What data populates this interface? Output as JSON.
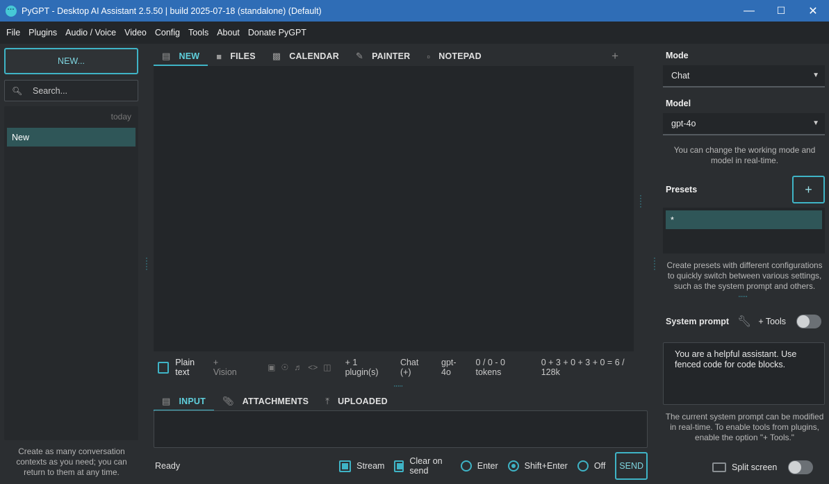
{
  "window": {
    "title": "PyGPT - Desktop AI Assistant 2.5.50 | build 2025-07-18 (standalone) (Default)",
    "minimize": "—",
    "maximize": "☐",
    "close": "✕"
  },
  "menu": [
    "File",
    "Plugins",
    "Audio / Voice",
    "Video",
    "Config",
    "Tools",
    "About",
    "Donate PyGPT"
  ],
  "left": {
    "new_button": "NEW...",
    "search_placeholder": "Search...",
    "group_label": "today",
    "contexts": [
      "New"
    ],
    "hint": "Create as many conversation contexts as you need; you can return to them at any time."
  },
  "tabs": [
    {
      "label": "NEW",
      "icon": "chat-icon",
      "active": true
    },
    {
      "label": "FILES",
      "icon": "folder-icon",
      "active": false
    },
    {
      "label": "CALENDAR",
      "icon": "calendar-icon",
      "active": false
    },
    {
      "label": "PAINTER",
      "icon": "brush-icon",
      "active": false
    },
    {
      "label": "NOTEPAD",
      "icon": "clipboard-icon",
      "active": false
    }
  ],
  "status": {
    "plain_text": "Plain text",
    "vision": "+ Vision",
    "plugins": "+ 1 plugin(s)",
    "mode": "Chat (+)",
    "model": "gpt-4o",
    "tokens": "0 / 0 - 0 tokens",
    "ctx": "0 + 3 + 0 + 3 + 0 = 6 / 128k"
  },
  "input_tabs": [
    {
      "label": "INPUT",
      "active": true
    },
    {
      "label": "ATTACHMENTS",
      "active": false
    },
    {
      "label": "UPLOADED",
      "active": false
    }
  ],
  "bottom": {
    "status": "Ready",
    "stream": "Stream",
    "clear_on_send": "Clear on send",
    "enter": "Enter",
    "shift_enter": "Shift+Enter",
    "off": "Off",
    "send": "SEND"
  },
  "right": {
    "mode_label": "Mode",
    "mode_value": "Chat",
    "model_label": "Model",
    "model_value": "gpt-4o",
    "mode_hint": "You can change the working mode and model in real-time.",
    "presets_label": "Presets",
    "preset_add": "+",
    "presets": [
      "*"
    ],
    "presets_hint": "Create presets with different configurations to quickly switch between various settings, such as the system prompt and others.",
    "system_prompt_label": "System prompt",
    "tools_label": "+ Tools",
    "system_prompt_value": "You are a helpful assistant. Use fenced code for code blocks.",
    "system_prompt_hint": "The current system prompt can be modified in real-time. To enable tools from plugins, enable the option \"+ Tools.\"",
    "split_screen": "Split screen"
  },
  "colors": {
    "accent": "#3fb4c6",
    "titlebar": "#2f6db6",
    "selection": "#2f5658"
  }
}
